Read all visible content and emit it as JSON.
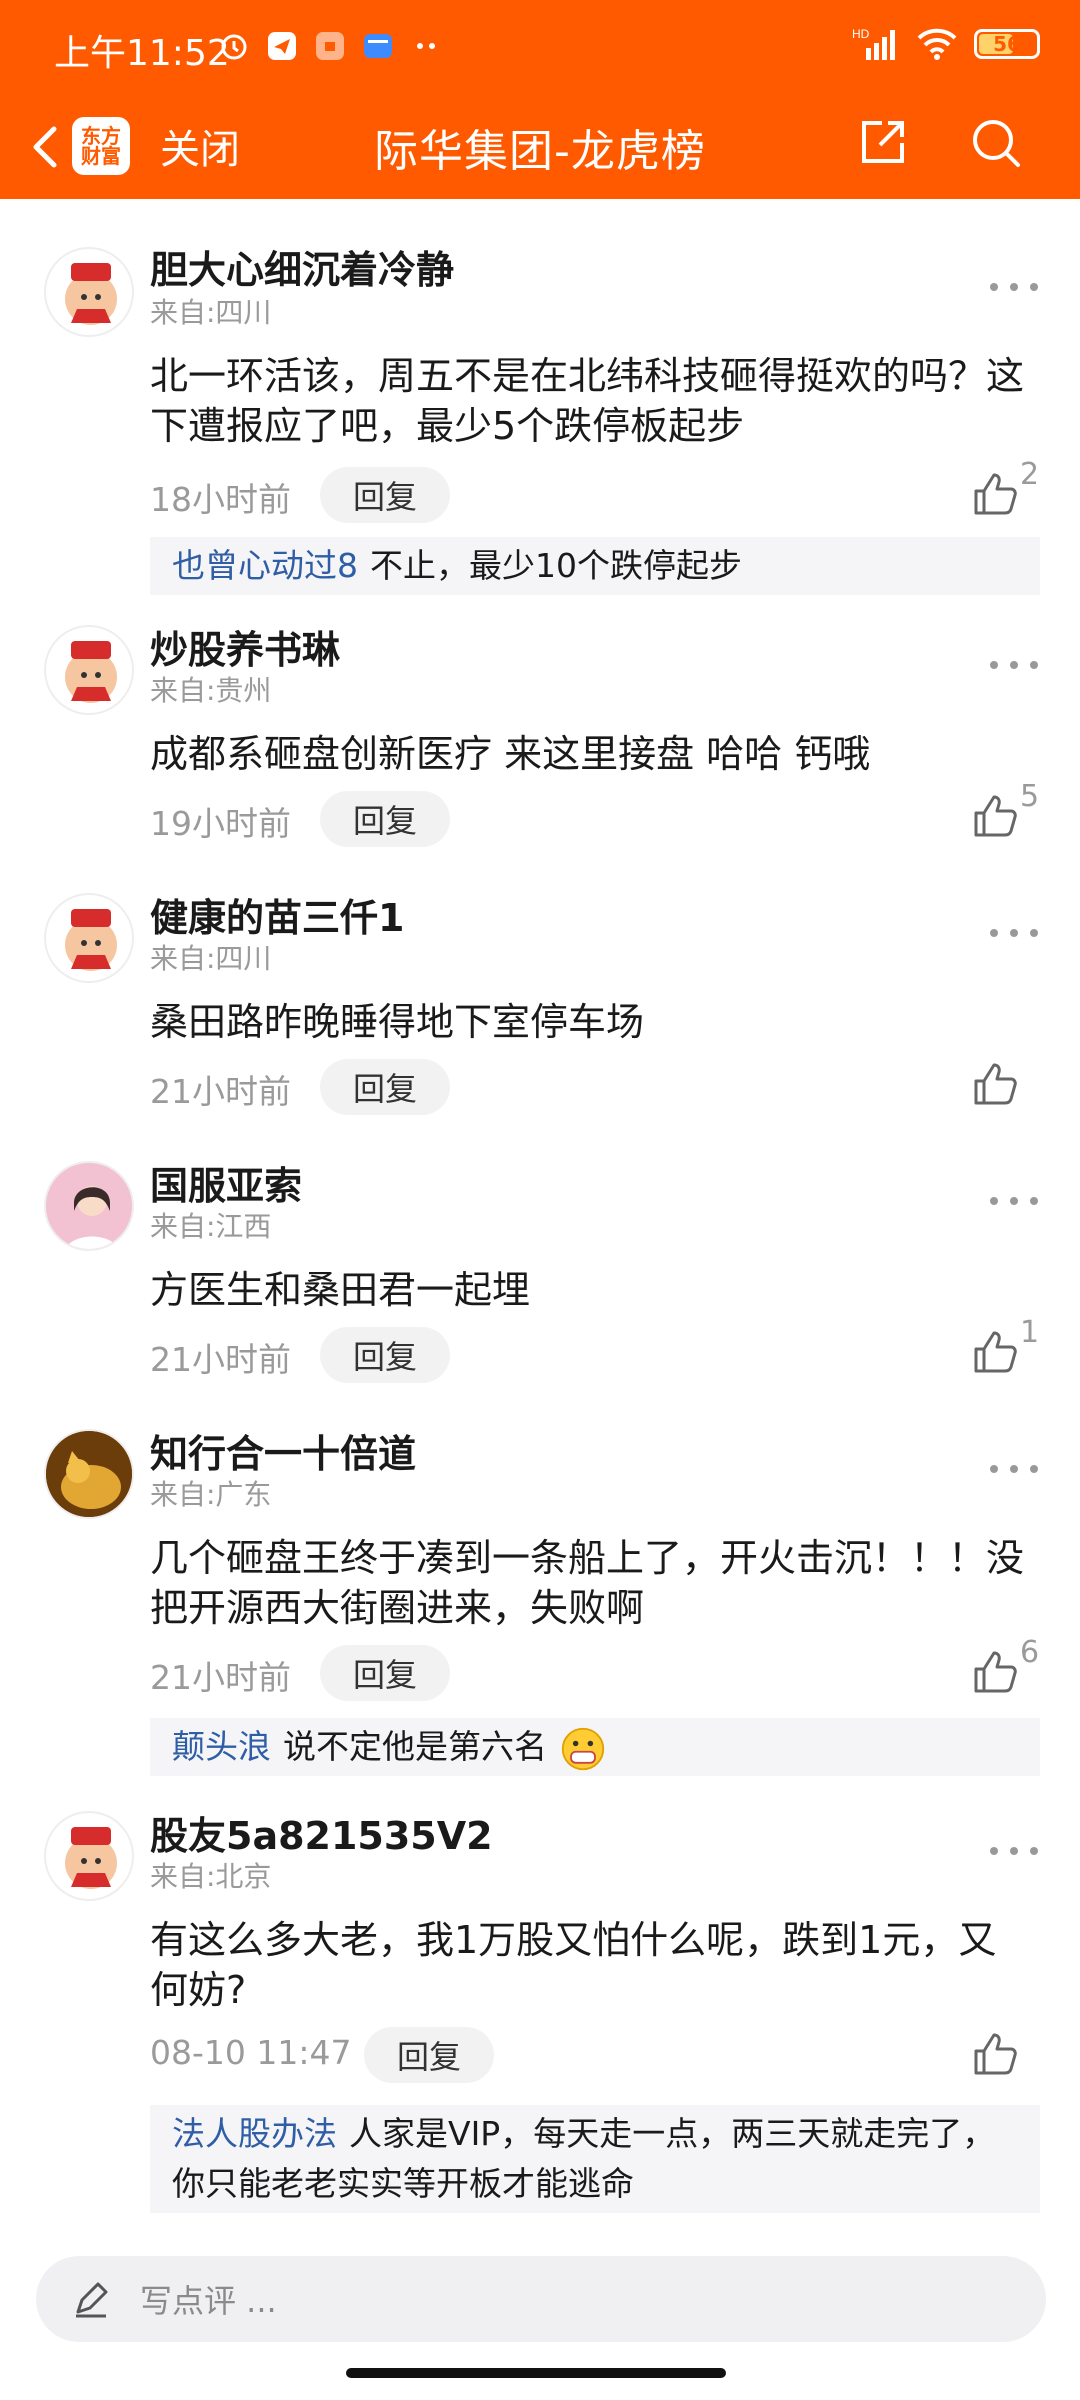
{
  "status_bar": {
    "time": "上午11:52",
    "network_label": "HD",
    "battery": "56"
  },
  "header": {
    "close_label": "关闭",
    "title": "际华集团-龙虎榜",
    "logo_line1": "东方",
    "logo_line2": "财富"
  },
  "comments": [
    {
      "username": "胆大心细沉着冷静",
      "from": "来自:四川",
      "text": "北一环活该，周五不是在北纬科技砸得挺欢的吗？这下遭报应了吧，最少5个跌停板起步",
      "time": "18小时前",
      "reply_label": "回复",
      "likes": "2",
      "sub_reply": {
        "user": "也曾心动过8",
        "text": "不止，最少10个跌停起步"
      }
    },
    {
      "username": "炒股养书琳",
      "from": "来自:贵州",
      "text": "成都系砸盘创新医疗 来这里接盘 哈哈 钙哦",
      "time": "19小时前",
      "reply_label": "回复",
      "likes": "5"
    },
    {
      "username": "健康的苗三仟1",
      "from": "来自:四川",
      "text": "桑田路昨晚睡得地下室停车场",
      "time": "21小时前",
      "reply_label": "回复",
      "likes": ""
    },
    {
      "username": "国服亚索",
      "from": "来自:江西",
      "text": "方医生和桑田君一起埋",
      "time": "21小时前",
      "reply_label": "回复",
      "likes": "1"
    },
    {
      "username": "知行合一十倍道",
      "from": "来自:广东",
      "text": "几个砸盘王终于凑到一条船上了，开火击沉！！！没把开源西大街圈进来，失败啊",
      "time": "21小时前",
      "reply_label": "回复",
      "likes": "6",
      "sub_reply": {
        "user": "颠头浪",
        "text": "说不定他是第六名"
      }
    },
    {
      "username": "股友5a821535V2",
      "from": "来自:北京",
      "text": "有这么多大老，我1万股又怕什么呢，跌到1元，又何妨?",
      "time": "08-10 11:47",
      "reply_label": "回复",
      "likes": "",
      "sub_reply": {
        "user": "法人股办法",
        "text": "人家是VIP，每天走一点，两三天就走完了，你只能老老实实等开板才能逃命"
      }
    }
  ],
  "input": {
    "placeholder": "写点评 ..."
  },
  "colors": {
    "brand": "#ff5a00",
    "link": "#2f5ea6"
  }
}
